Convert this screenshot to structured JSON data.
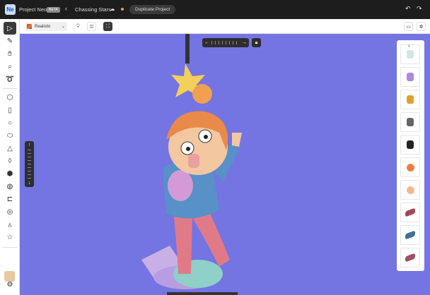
{
  "topbar": {
    "logo": "Ne",
    "app_name": "Project Neo",
    "badge": "BETA",
    "back_icon": "chevron-left-icon",
    "project_title": "Chassing Stars",
    "cloud_icon": "cloud-icon",
    "status_color": "#f0a040",
    "duplicate_label": "Duplicate Project",
    "undo_icon": "undo-icon",
    "redo_icon": "redo-icon"
  },
  "toolbar": {
    "render_mode": "Realistic",
    "light_icon": "lightbulb-icon",
    "view_icon": "view-toggle-icon",
    "frame_icon": "frame-icon",
    "right_icons": [
      "crop-icon",
      "settings-icon"
    ]
  },
  "sidebar": {
    "tools": [
      "select",
      "pen",
      "hand",
      "zoom",
      "lasso",
      "cube",
      "cylinder",
      "sphere",
      "capsule",
      "cone",
      "drop",
      "torus-knot",
      "blob",
      "box-open",
      "torus",
      "pyramid",
      "star"
    ],
    "swatch_color": "#e7c8a0",
    "settings_icon": "gear-icon"
  },
  "canvas": {
    "background": "#7474e2",
    "h_left": "←",
    "h_right": "→",
    "v_up": "↑",
    "v_down": "↓",
    "lock_icon": "lock-icon"
  },
  "assets": {
    "collapse": "‹",
    "items": [
      {
        "name": "glass-cylinder",
        "color": "#cfe6e6"
      },
      {
        "name": "purple-cylinder",
        "color": "#a98ae0"
      },
      {
        "name": "gift-box",
        "color": "#e0a030"
      },
      {
        "name": "gray-cylinder",
        "color": "#666666"
      },
      {
        "name": "black-cylinder",
        "color": "#222222"
      },
      {
        "name": "orange-sphere",
        "color": "#f08040"
      },
      {
        "name": "peach-sphere",
        "color": "#f4b890"
      },
      {
        "name": "red-bracket",
        "color": "#a04a55"
      },
      {
        "name": "blue-bracket",
        "color": "#4070a0"
      },
      {
        "name": "pink-bracket",
        "color": "#a05060"
      }
    ]
  }
}
